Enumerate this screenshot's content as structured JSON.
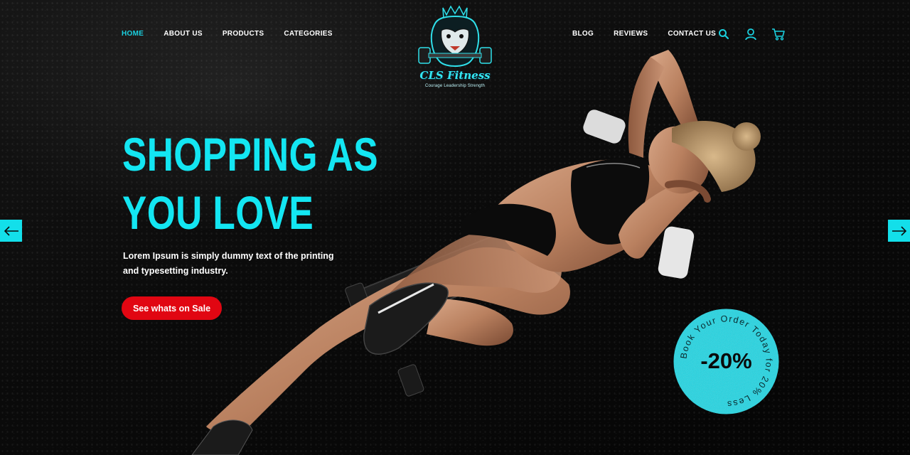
{
  "brand": {
    "name": "CLS Fitness",
    "tagline": "Courage Leadership Strength"
  },
  "nav": {
    "left": [
      {
        "label": "HOME",
        "active": true
      },
      {
        "label": "ABOUT US"
      },
      {
        "label": "PRODUCTS"
      },
      {
        "label": "CATEGORIES"
      }
    ],
    "right": [
      {
        "label": "BLOG"
      },
      {
        "label": "REVIEWS"
      },
      {
        "label": "CONTACT US"
      }
    ],
    "icons": [
      "search-icon",
      "user-icon",
      "cart-icon"
    ]
  },
  "hero": {
    "headline_line1": "SHOPPING AS",
    "headline_line2": "YOU LOVE",
    "lead": "Lorem Ipsum is simply dummy text of the printing and typesetting industry.",
    "cta_label": "See whats on Sale"
  },
  "badge": {
    "discount": "-20%",
    "ring_text": "Book Your Order Today for 20% Less"
  },
  "slider": {
    "prev_icon": "arrow-left-icon",
    "next_icon": "arrow-right-icon"
  },
  "colors": {
    "accent": "#13e6f2",
    "cta": "#e10612",
    "background": "#050505",
    "text": "#ffffff"
  }
}
